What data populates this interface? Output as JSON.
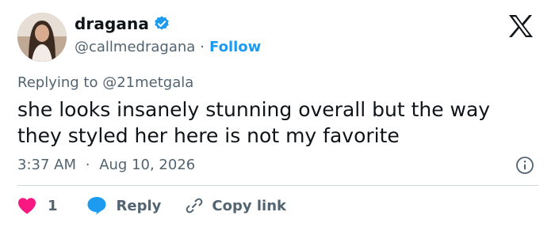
{
  "author": {
    "display_name": "dragana",
    "handle": "@callmedragana",
    "separator": "·",
    "follow_label": "Follow",
    "verified": true
  },
  "tweet": {
    "replying_prefix": "Replying to",
    "replying_to": "@21metgala",
    "text": "she looks insanely stunning overall but the way they styled her here is not my favorite",
    "time": "3:37 AM",
    "date_separator": "·",
    "date": "Aug 10, 2026"
  },
  "actions": {
    "like_count": "1",
    "reply_label": "Reply",
    "copy_label": "Copy link"
  },
  "colors": {
    "accent": "#1d9bf0",
    "like": "#f91880",
    "text": "#0f1419",
    "muted": "#536471",
    "divider": "#cfd9de"
  },
  "icons": [
    "verified-badge-icon",
    "x-logo-icon",
    "info-icon",
    "heart-icon",
    "reply-bubble-icon",
    "link-icon"
  ]
}
